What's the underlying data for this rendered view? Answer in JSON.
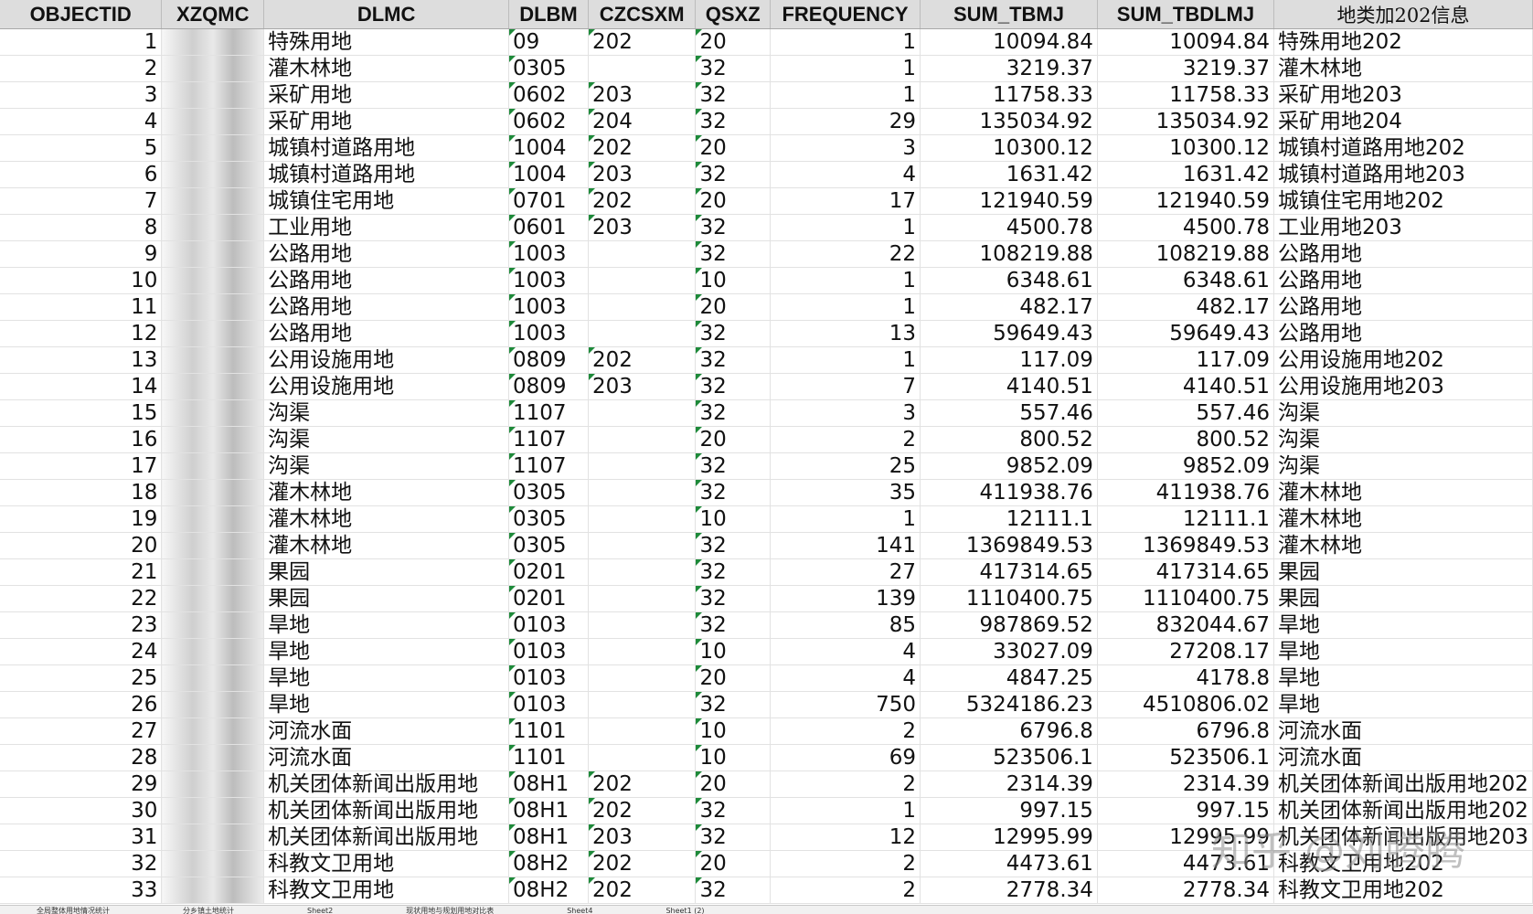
{
  "columns": [
    {
      "label": "OBJECTID",
      "width": 197,
      "align": "num"
    },
    {
      "label": "XZQMC",
      "width": 120,
      "align": "blur"
    },
    {
      "label": "DLMC",
      "width": 278,
      "align": "txt"
    },
    {
      "label": "DLBM",
      "width": 92,
      "align": "txt",
      "flag": true
    },
    {
      "label": "CZCSXM",
      "width": 123,
      "align": "txt",
      "flag": true
    },
    {
      "label": "QSXZ",
      "width": 86,
      "align": "txt",
      "flag": true
    },
    {
      "label": "FREQUENCY",
      "width": 170,
      "align": "num"
    },
    {
      "label": "SUM_TBMJ",
      "width": 210,
      "align": "num"
    },
    {
      "label": "SUM_TBDLMJ",
      "width": 205,
      "align": "num"
    },
    {
      "label": "地类加202信息",
      "width": 196,
      "align": "txt",
      "cn": true
    }
  ],
  "rows": [
    [
      "1",
      "",
      "特殊用地",
      "09",
      "202",
      "20",
      "1",
      "10094.84",
      "10094.84",
      "特殊用地202"
    ],
    [
      "2",
      "",
      "灌木林地",
      "0305",
      "",
      "32",
      "1",
      "3219.37",
      "3219.37",
      "灌木林地"
    ],
    [
      "3",
      "",
      "采矿用地",
      "0602",
      "203",
      "32",
      "1",
      "11758.33",
      "11758.33",
      "采矿用地203"
    ],
    [
      "4",
      "",
      "采矿用地",
      "0602",
      "204",
      "32",
      "29",
      "135034.92",
      "135034.92",
      "采矿用地204"
    ],
    [
      "5",
      "",
      "城镇村道路用地",
      "1004",
      "202",
      "20",
      "3",
      "10300.12",
      "10300.12",
      "城镇村道路用地202"
    ],
    [
      "6",
      "",
      "城镇村道路用地",
      "1004",
      "203",
      "32",
      "4",
      "1631.42",
      "1631.42",
      "城镇村道路用地203"
    ],
    [
      "7",
      "",
      "城镇住宅用地",
      "0701",
      "202",
      "20",
      "17",
      "121940.59",
      "121940.59",
      "城镇住宅用地202"
    ],
    [
      "8",
      "",
      "工业用地",
      "0601",
      "203",
      "32",
      "1",
      "4500.78",
      "4500.78",
      "工业用地203"
    ],
    [
      "9",
      "",
      "公路用地",
      "1003",
      "",
      "32",
      "22",
      "108219.88",
      "108219.88",
      "公路用地"
    ],
    [
      "10",
      "",
      "公路用地",
      "1003",
      "",
      "10",
      "1",
      "6348.61",
      "6348.61",
      "公路用地"
    ],
    [
      "11",
      "",
      "公路用地",
      "1003",
      "",
      "20",
      "1",
      "482.17",
      "482.17",
      "公路用地"
    ],
    [
      "12",
      "",
      "公路用地",
      "1003",
      "",
      "32",
      "13",
      "59649.43",
      "59649.43",
      "公路用地"
    ],
    [
      "13",
      "",
      "公用设施用地",
      "0809",
      "202",
      "32",
      "1",
      "117.09",
      "117.09",
      "公用设施用地202"
    ],
    [
      "14",
      "",
      "公用设施用地",
      "0809",
      "203",
      "32",
      "7",
      "4140.51",
      "4140.51",
      "公用设施用地203"
    ],
    [
      "15",
      "",
      "沟渠",
      "1107",
      "",
      "32",
      "3",
      "557.46",
      "557.46",
      "沟渠"
    ],
    [
      "16",
      "",
      "沟渠",
      "1107",
      "",
      "20",
      "2",
      "800.52",
      "800.52",
      "沟渠"
    ],
    [
      "17",
      "",
      "沟渠",
      "1107",
      "",
      "32",
      "25",
      "9852.09",
      "9852.09",
      "沟渠"
    ],
    [
      "18",
      "",
      "灌木林地",
      "0305",
      "",
      "32",
      "35",
      "411938.76",
      "411938.76",
      "灌木林地"
    ],
    [
      "19",
      "",
      "灌木林地",
      "0305",
      "",
      "10",
      "1",
      "12111.1",
      "12111.1",
      "灌木林地"
    ],
    [
      "20",
      "",
      "灌木林地",
      "0305",
      "",
      "32",
      "141",
      "1369849.53",
      "1369849.53",
      "灌木林地"
    ],
    [
      "21",
      "",
      "果园",
      "0201",
      "",
      "32",
      "27",
      "417314.65",
      "417314.65",
      "果园"
    ],
    [
      "22",
      "",
      "果园",
      "0201",
      "",
      "32",
      "139",
      "1110400.75",
      "1110400.75",
      "果园"
    ],
    [
      "23",
      "",
      "旱地",
      "0103",
      "",
      "32",
      "85",
      "987869.52",
      "832044.67",
      "旱地"
    ],
    [
      "24",
      "",
      "旱地",
      "0103",
      "",
      "10",
      "4",
      "33027.09",
      "27208.17",
      "旱地"
    ],
    [
      "25",
      "",
      "旱地",
      "0103",
      "",
      "20",
      "4",
      "4847.25",
      "4178.8",
      "旱地"
    ],
    [
      "26",
      "",
      "旱地",
      "0103",
      "",
      "32",
      "750",
      "5324186.23",
      "4510806.02",
      "旱地"
    ],
    [
      "27",
      "",
      "河流水面",
      "1101",
      "",
      "10",
      "2",
      "6796.8",
      "6796.8",
      "河流水面"
    ],
    [
      "28",
      "",
      "河流水面",
      "1101",
      "",
      "10",
      "69",
      "523506.1",
      "523506.1",
      "河流水面"
    ],
    [
      "29",
      "",
      "机关团体新闻出版用地",
      "08H1",
      "202",
      "20",
      "2",
      "2314.39",
      "2314.39",
      "机关团体新闻出版用地202"
    ],
    [
      "30",
      "",
      "机关团体新闻出版用地",
      "08H1",
      "202",
      "32",
      "1",
      "997.15",
      "997.15",
      "机关团体新闻出版用地202"
    ],
    [
      "31",
      "",
      "机关团体新闻出版用地",
      "08H1",
      "203",
      "32",
      "12",
      "12995.99",
      "12995.99",
      "机关团体新闻出版用地203"
    ],
    [
      "32",
      "",
      "科教文卫用地",
      "08H2",
      "202",
      "20",
      "2",
      "4473.61",
      "4473.61",
      "科教文卫用地202"
    ],
    [
      "33",
      "",
      "科教文卫用地",
      "08H2",
      "202",
      "32",
      "2",
      "2778.34",
      "2778.34",
      "科教文卫用地202"
    ]
  ],
  "watermark": "知乎 @刘腾腾",
  "sheet_tabs": [
    "全局整体用地情况统计",
    "分乡镇土地统计",
    "Sheet2",
    "现状用地与规划用地对比表",
    "Sheet4",
    "Sheet1 (2)"
  ]
}
